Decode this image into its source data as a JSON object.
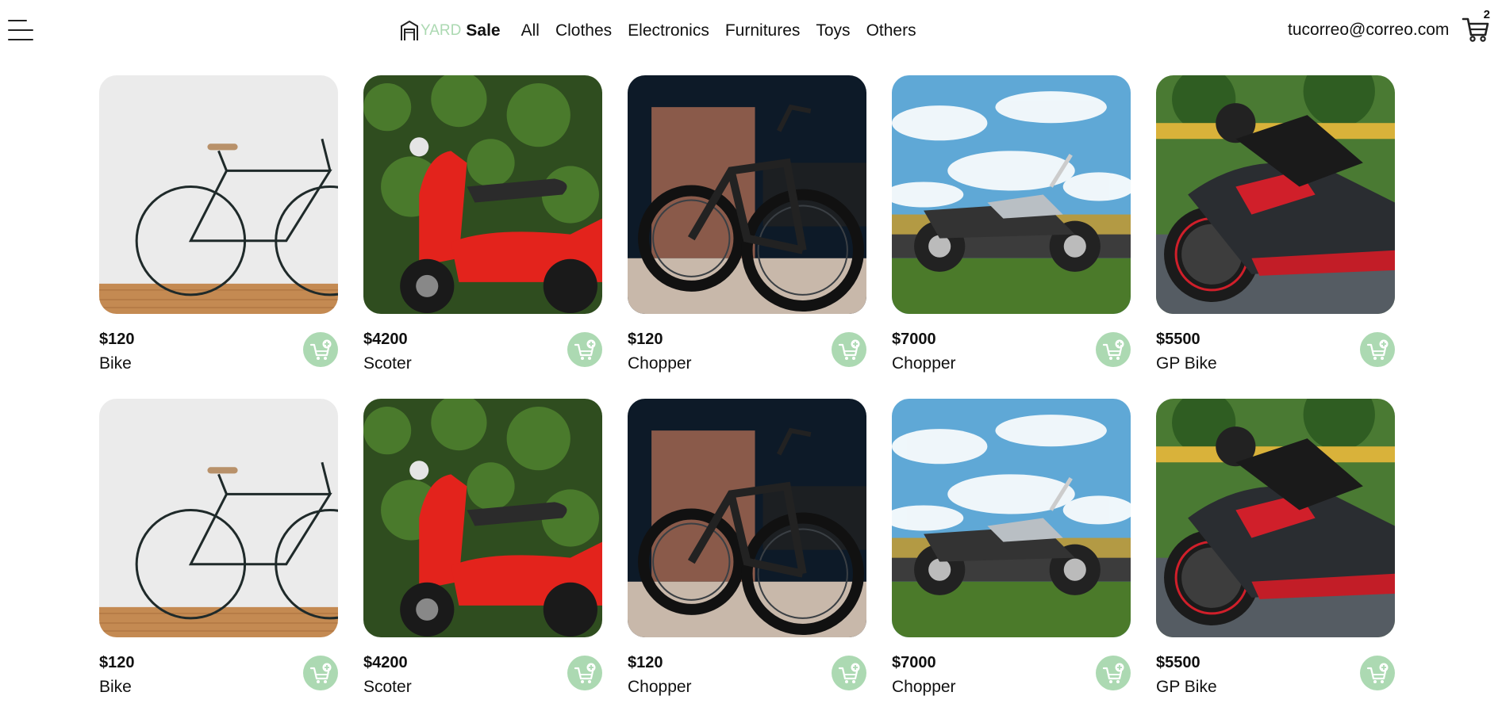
{
  "header": {
    "logo_part1": "YARD",
    "logo_part2": "Sale",
    "nav": [
      "All",
      "Clothes",
      "Electronics",
      "Furnitures",
      "Toys",
      "Others"
    ],
    "account_email": "tucorreo@correo.com",
    "cart_count": "2"
  },
  "icons": {
    "menu": "hamburger-menu-icon",
    "logo": "house-logo-icon",
    "cart": "shopping-cart-icon",
    "add": "cart-add-icon"
  },
  "colors": {
    "accent": "#acd9b2",
    "text": "#111111",
    "background": "#ffffff"
  },
  "products": [
    {
      "price": "$120",
      "name": "Bike",
      "image": "bicycle"
    },
    {
      "price": "$4200",
      "name": "Scoter",
      "image": "scooter"
    },
    {
      "price": "$120",
      "name": "Chopper",
      "image": "ebike"
    },
    {
      "price": "$7000",
      "name": "Chopper",
      "image": "motorcycle"
    },
    {
      "price": "$5500",
      "name": "GP Bike",
      "image": "sportbike"
    },
    {
      "price": "$120",
      "name": "Bike",
      "image": "bicycle"
    },
    {
      "price": "$4200",
      "name": "Scoter",
      "image": "scooter"
    },
    {
      "price": "$120",
      "name": "Chopper",
      "image": "ebike"
    },
    {
      "price": "$7000",
      "name": "Chopper",
      "image": "motorcycle"
    },
    {
      "price": "$5500",
      "name": "GP Bike",
      "image": "sportbike"
    }
  ]
}
